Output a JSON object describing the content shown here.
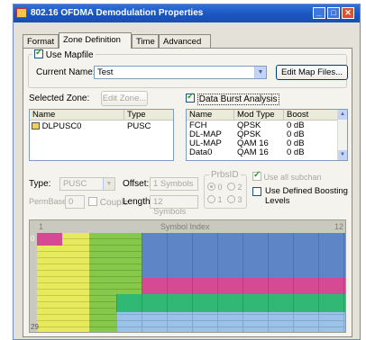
{
  "window": {
    "title": "802.16 OFDMA Demodulation Properties",
    "min": "_",
    "max": "□",
    "close": "✕"
  },
  "tabs": [
    {
      "label": "Format"
    },
    {
      "label": "Zone Definition"
    },
    {
      "label": "Time"
    },
    {
      "label": "Advanced"
    }
  ],
  "mapfile": {
    "use_label": "Use Mapfile",
    "current_name_label": "Current Name:",
    "current_name_value": "Test",
    "edit_map_files": "Edit Map Files..."
  },
  "zone": {
    "selected_label": "Selected Zone:",
    "edit_zone": "Edit Zone...",
    "headers": [
      "Name",
      "Type"
    ],
    "rows": [
      {
        "name": "DLPUSC0",
        "type": "PUSC"
      }
    ]
  },
  "burst": {
    "analysis_label": "Data Burst Analysis",
    "headers": [
      "Name",
      "Mod Type",
      "Boost"
    ],
    "rows": [
      {
        "name": "FCH",
        "mod": "QPSK",
        "boost": "0 dB"
      },
      {
        "name": "DL-MAP",
        "mod": "QPSK",
        "boost": "0 dB"
      },
      {
        "name": "UL-MAP",
        "mod": "QAM 16",
        "boost": "0 dB"
      },
      {
        "name": "Data0",
        "mod": "QAM 16",
        "boost": "0 dB"
      }
    ]
  },
  "params": {
    "type_label": "Type:",
    "type_value": "PUSC",
    "offset_label": "Offset:",
    "offset_value": "1 Symbols",
    "length_label": "Length:",
    "length_value": "12 Symbols",
    "permbase_label": "PermBase:",
    "permbase_value": "0",
    "couple_label": "Couple",
    "prbs_label": "PrbsID",
    "prbs_options": [
      "0",
      "2",
      "1",
      "3"
    ],
    "use_all_subchan": "Use all subchan",
    "use_defined_boosting": "Use Defined Boosting Levels"
  },
  "symbol_map": {
    "header": "Symbol Index",
    "start": "1",
    "end": "12",
    "row_start": "0",
    "row_end": "29",
    "colors": {
      "yellow": "#e7ea5c",
      "green": "#86c84a",
      "magenta": "#d64a94",
      "blue": "#5e86c6",
      "bright_green": "#31b874",
      "light_blue": "#9cc3e6"
    }
  }
}
